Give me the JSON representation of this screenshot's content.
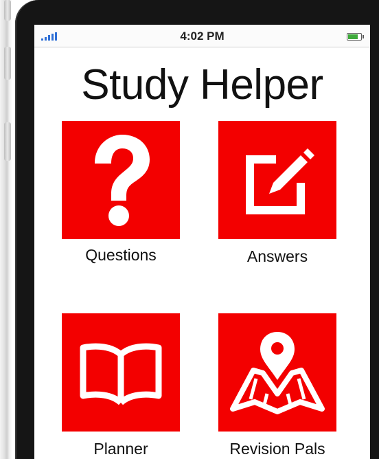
{
  "status_bar": {
    "time": "4:02 PM"
  },
  "app": {
    "title": "Study Helper"
  },
  "tiles": [
    {
      "label": "Questions",
      "icon": "question-mark-icon"
    },
    {
      "label": "Answers",
      "icon": "edit-icon"
    },
    {
      "label": "Planner",
      "icon": "book-icon"
    },
    {
      "label": "Revision Pals",
      "icon": "map-pin-icon"
    }
  ],
  "colors": {
    "tile": "#f30000",
    "signal": "#2f6fd6",
    "battery": "#3faa3c"
  }
}
